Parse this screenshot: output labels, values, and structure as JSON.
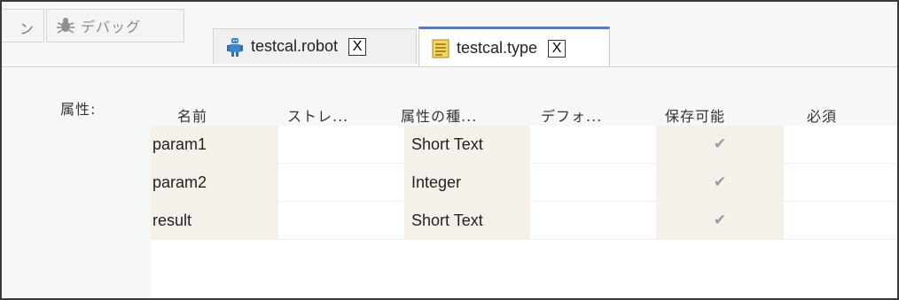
{
  "toolbar": {
    "partial_button_label": "ン",
    "debug_button_label": "デバッグ",
    "debug_icon": "bug-icon"
  },
  "tabs": [
    {
      "label": "testcal.robot",
      "icon": "robot-icon",
      "close": "X",
      "active": false
    },
    {
      "label": "testcal.type",
      "icon": "document-icon",
      "close": "X",
      "active": true
    }
  ],
  "attributes": {
    "section_label": "属性:",
    "columns": [
      "名前",
      "ストレ...",
      "属性の種...",
      "デフォ...",
      "保存可能",
      "必須"
    ],
    "rows": [
      {
        "name": "param1",
        "storage": "",
        "type": "Short Text",
        "default": "",
        "savable": "✔",
        "required": ""
      },
      {
        "name": "param2",
        "storage": "",
        "type": "Integer",
        "default": "",
        "savable": "✔",
        "required": ""
      },
      {
        "name": "result",
        "storage": "",
        "type": "Short Text",
        "default": "",
        "savable": "✔",
        "required": ""
      }
    ]
  },
  "colors": {
    "active_tab_accent": "#5a7fb5",
    "shaded_cell": "#f5f1ea",
    "check_mark": "#9a9a9a"
  }
}
